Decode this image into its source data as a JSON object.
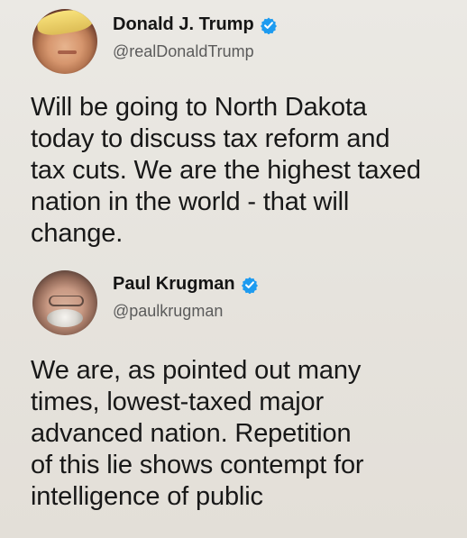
{
  "colors": {
    "background": "#e7e4de",
    "text": "#181818",
    "handle": "#5b5b5b",
    "verified": "#1d9bf0"
  },
  "tweets": [
    {
      "avatar": "avatar",
      "display_name": "Donald J. Trump",
      "verified_icon": "verified-icon",
      "handle": "@realDonaldTrump",
      "lines": [
        "Will be going to North Dakota",
        "today to discuss tax reform and",
        "tax cuts. We are the highest taxed",
        "nation in the world - that will",
        "change."
      ]
    },
    {
      "avatar": "avatar",
      "display_name": "Paul Krugman",
      "verified_icon": "verified-icon",
      "handle": "@paulkrugman",
      "lines": [
        "We are, as pointed out many",
        "times, lowest-taxed major",
        "advanced nation. Repetition",
        "of this lie shows contempt for",
        "intelligence of public"
      ]
    }
  ]
}
